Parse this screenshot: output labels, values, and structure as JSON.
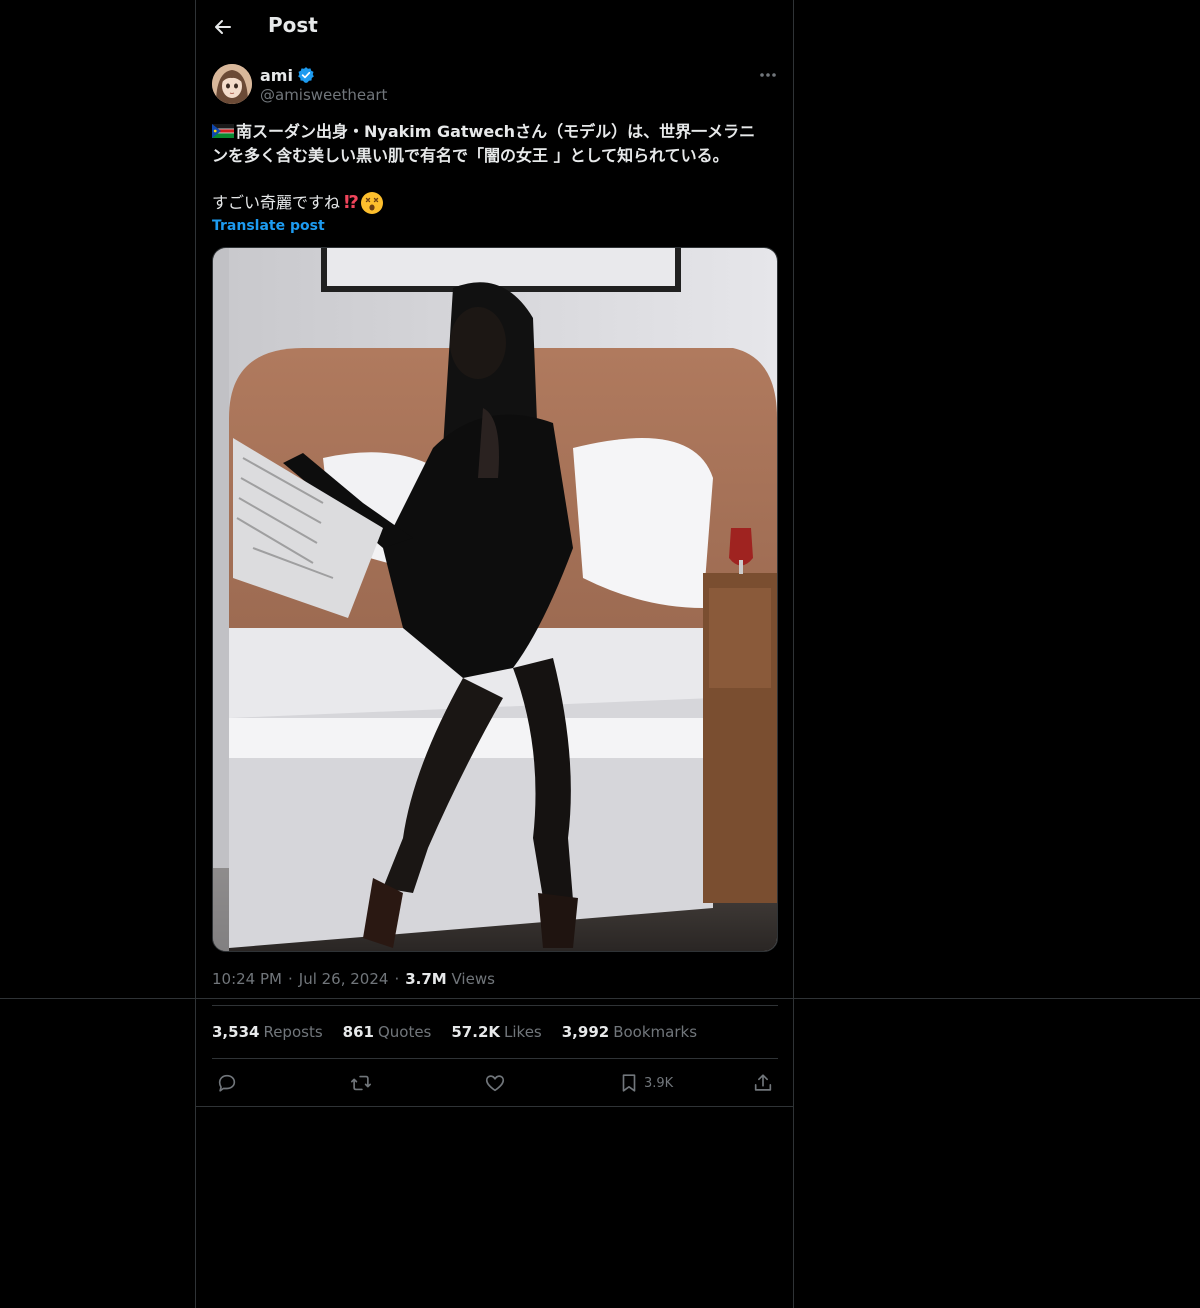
{
  "header": {
    "title": "Post"
  },
  "author": {
    "name": "ami",
    "handle": "@amisweetheart",
    "verified": true
  },
  "post": {
    "line1": "南スーダン出身・Nyakim Gatwechさん（モデル）は、世界一メラニ",
    "line2": "ンを多く含む美しい黒い肌で有名で「闇の女王 」として知られている。",
    "line3": "すごい奇麗ですね",
    "interrobang": "⁉",
    "translate_label": "Translate post"
  },
  "meta": {
    "time": "10:24 PM",
    "dot": "·",
    "date": "Jul 26, 2024",
    "views_count": "3.7M",
    "views_label": "Views"
  },
  "stats": [
    {
      "count": "3,534",
      "label": "Reposts"
    },
    {
      "count": "861",
      "label": "Quotes"
    },
    {
      "count": "57.2K",
      "label": "Likes"
    },
    {
      "count": "3,992",
      "label": "Bookmarks"
    }
  ],
  "actions": {
    "bookmark_count": "3.9K"
  },
  "colors": {
    "accent": "#1d9bf0",
    "text": "#e7e9ea",
    "muted": "#71767b",
    "border": "#2f3336"
  }
}
